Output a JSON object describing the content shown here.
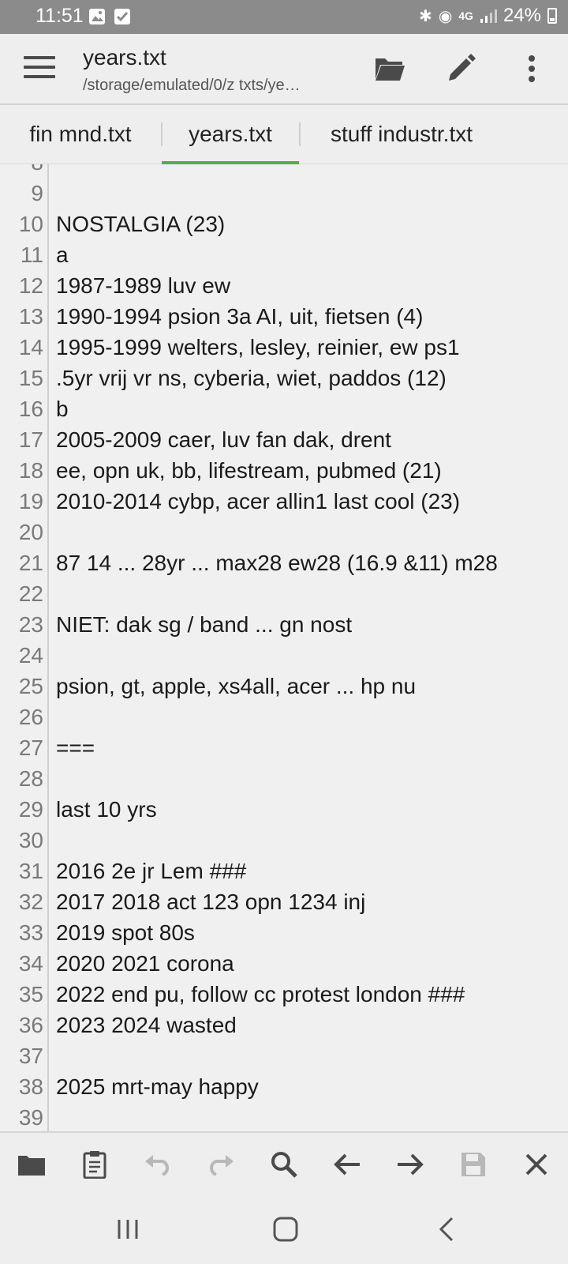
{
  "status_bar": {
    "time": "11:51",
    "network": "4G",
    "battery": "24%"
  },
  "app_bar": {
    "title": "years.txt",
    "subtitle": "/storage/emulated/0/z txts/ye…"
  },
  "tabs": [
    {
      "label": "fin mnd.txt",
      "active": false
    },
    {
      "label": "years.txt",
      "active": true
    },
    {
      "label": "stuff industr.txt",
      "active": false
    }
  ],
  "colors": {
    "accent": "#4caf50",
    "status_bar": "#8b8b8b",
    "icon": "#4a4a4a",
    "icon_disabled": "#b8b8b8"
  },
  "lines": [
    {
      "num": "9",
      "text": ""
    },
    {
      "num": "10",
      "text": "NOSTALGIA (23)"
    },
    {
      "num": "11",
      "text": "a"
    },
    {
      "num": "12",
      "text": "1987-1989 luv ew"
    },
    {
      "num": "13",
      "text": "1990-1994 psion 3a AI, uit, fietsen (4)"
    },
    {
      "num": "14",
      "text": "1995-1999 welters, lesley, reinier, ew ps1"
    },
    {
      "num": "15",
      "text": ".5yr vrij vr ns, cyberia, wiet, paddos (12)"
    },
    {
      "num": "16",
      "text": "b"
    },
    {
      "num": "17",
      "text": "2005-2009 caer, luv fan dak, drent"
    },
    {
      "num": "18",
      "text": "ee, opn uk, bb, lifestream, pubmed (21)"
    },
    {
      "num": "19",
      "text": "2010-2014 cybp, acer allin1 last cool (23)"
    },
    {
      "num": "20",
      "text": ""
    },
    {
      "num": "21",
      "text": "87 14 ... 28yr ... max28 ew28 (16.9 &11) m28"
    },
    {
      "num": "22",
      "text": ""
    },
    {
      "num": "23",
      "text": "NIET: dak sg / band ... gn nost"
    },
    {
      "num": "24",
      "text": ""
    },
    {
      "num": "25",
      "text": "psion, gt, apple, xs4all, acer ... hp nu"
    },
    {
      "num": "26",
      "text": ""
    },
    {
      "num": "27",
      "text": "==="
    },
    {
      "num": "28",
      "text": ""
    },
    {
      "num": "29",
      "text": "last 10 yrs"
    },
    {
      "num": "30",
      "text": ""
    },
    {
      "num": "31",
      "text": "2016 2e jr Lem ###"
    },
    {
      "num": "32",
      "text": "2017 2018 act 123 opn 1234 inj"
    },
    {
      "num": "33",
      "text": "2019 spot 80s"
    },
    {
      "num": "34",
      "text": "2020 2021 corona"
    },
    {
      "num": "35",
      "text": "2022 end pu, follow cc protest london ###"
    },
    {
      "num": "36",
      "text": "2023 2024 wasted"
    },
    {
      "num": "37",
      "text": ""
    },
    {
      "num": "38",
      "text": "2025 mrt-may happy"
    },
    {
      "num": "39",
      "text": ""
    }
  ],
  "toolbar_icons": [
    "folder-icon",
    "clipboard-icon",
    "undo-icon",
    "redo-icon",
    "search-icon",
    "arrow-left-icon",
    "arrow-right-icon",
    "save-icon",
    "close-icon"
  ],
  "nav_icons": [
    "recent-apps-icon",
    "home-icon",
    "back-icon"
  ]
}
